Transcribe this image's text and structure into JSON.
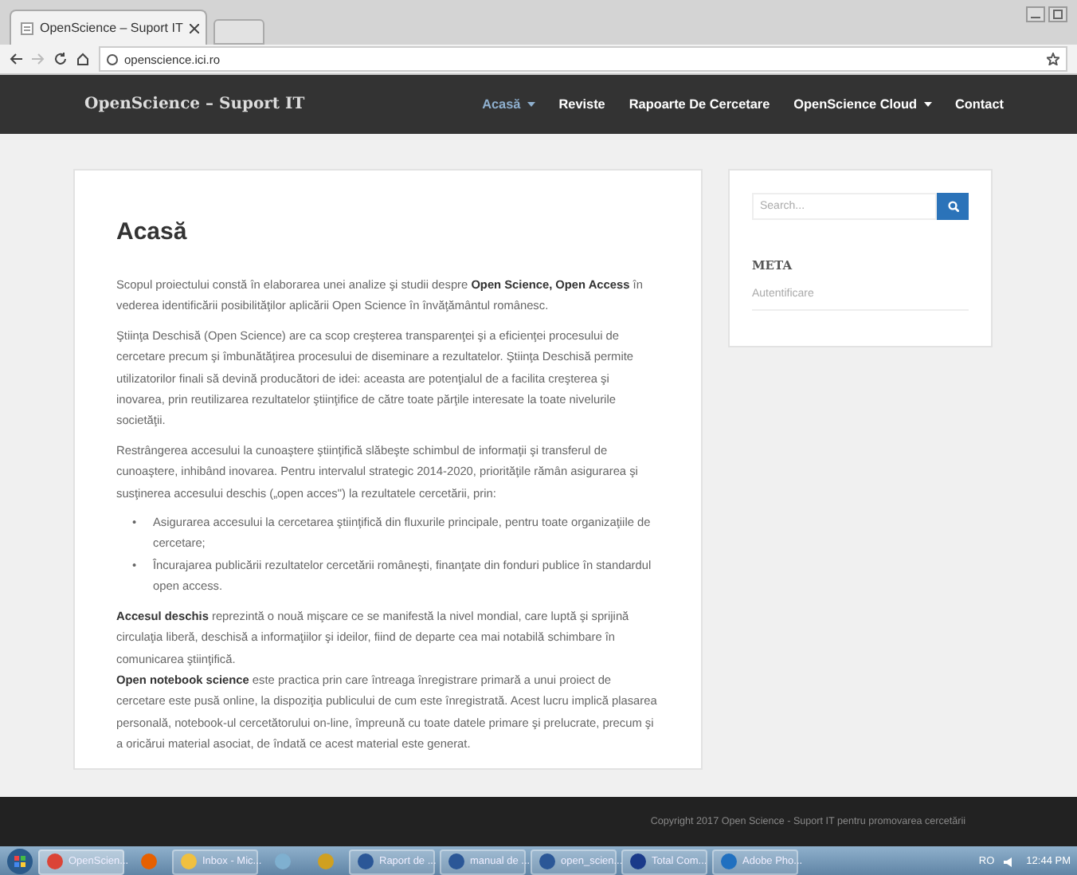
{
  "browser": {
    "tab_title": "OpenScience – Suport IT",
    "url": "openscience.ici.ro"
  },
  "site": {
    "brand": "OpenScience – Suport IT",
    "nav": [
      {
        "label": "Acasă",
        "selected": true,
        "dropdown": true
      },
      {
        "label": "Reviste",
        "selected": false,
        "dropdown": false
      },
      {
        "label": "Rapoarte De Cercetare",
        "selected": false,
        "dropdown": false
      },
      {
        "label": "OpenScience Cloud",
        "selected": false,
        "dropdown": true
      },
      {
        "label": "Contact",
        "selected": false,
        "dropdown": false
      }
    ]
  },
  "article": {
    "title": "Acasă",
    "blocks": [
      {
        "kind": "paragraph",
        "text": "Scopul proiectului constă în elaborarea unei analize şi studii despre **Open Science, Open Access** în vederea identificării posibilităţilor aplicării Open Science în învăţământul românesc."
      },
      {
        "kind": "paragraph",
        "text": "Ştiinţa Deschisă (Open Science) are ca scop creşterea transparenţei şi a eficienţei procesului de cercetare precum şi îmbunătăţirea procesului de diseminare a rezultatelor.  Ştiinţa Deschisă permite utilizatorilor finali să devină producători de idei: aceasta are potenţialul de a facilita creşterea şi inovarea, prin reutilizarea rezultatelor ştiinţifice de către toate părţile interesate la toate nivelurile societăţii."
      },
      {
        "kind": "paragraph",
        "text": "Restrângerea accesului la cunoaştere ştiinţifică slăbeşte schimbul de informaţii şi transferul de cunoaştere, inhibând inovarea. Pentru intervalul strategic 2014-2020, priorităţile rămân asigurarea şi susţinerea accesului deschis („open acces\") la rezultatele cercetării, prin:"
      },
      {
        "kind": "bullets",
        "items": [
          {
            "marker": "•",
            "text": "Asigurarea accesului la cercetarea ştiinţifică din fluxurile principale, pentru toate organizaţiile de cercetare;"
          },
          {
            "marker": "•",
            "text": "Încurajarea publicării rezultatelor cercetării româneşti, finanţate din fonduri publice în standardul open access."
          }
        ]
      },
      {
        "kind": "paragraph",
        "text": "**Accesul deschis** reprezintă o nouă mişcare ce se manifestă la nivel mondial, care luptă şi sprijină circulaţia liberă, deschisă a informaţiilor şi ideilor, fiind de departe cea mai notabilă schimbare în comunicarea ştiinţifică."
      },
      {
        "kind": "continuation",
        "text": "**Open notebook science** este practica prin care întreaga înregistrare primară a unui proiect de cercetare este pusă online, la dispoziţia publicului de cum este înregistrată. Acest lucru implică plasarea personală, notebook-ul cercetătorului on-line, împreună cu toate datele primare şi prelucrate, precum şi a oricărui material asociat, de îndată ce acest material este generat."
      }
    ]
  },
  "sidebar": {
    "search": {
      "placeholder": "Search..."
    },
    "meta_title": "META",
    "links": [
      "Autentificare"
    ]
  },
  "footer": {
    "copyright": "Copyright 2017 Open Science - Suport IT pentru promovarea cercetării"
  },
  "taskbar": {
    "items": [
      {
        "kind": "app",
        "label": "OpenScien...",
        "color": "#db4437",
        "selected": true
      },
      {
        "kind": "icon",
        "color": "#e66000",
        "selected": false
      },
      {
        "kind": "app",
        "label": "Inbox - Mic...",
        "color": "#f0c040",
        "selected": false
      },
      {
        "kind": "icon",
        "color": "#7fb0d0",
        "selected": false
      },
      {
        "kind": "icon",
        "color": "#d0a020",
        "selected": false
      },
      {
        "kind": "app",
        "label": "Raport de ...",
        "color": "#2b5797",
        "selected": false
      },
      {
        "kind": "app",
        "label": "manual de ...",
        "color": "#2b5797",
        "selected": false
      },
      {
        "kind": "app",
        "label": "open_scien...",
        "color": "#2b5797",
        "selected": false
      },
      {
        "kind": "app",
        "label": "Total Com...",
        "color": "#1a3a8a",
        "selected": false
      },
      {
        "kind": "app",
        "label": "Adobe Pho...",
        "color": "#2070c0",
        "selected": false
      }
    ],
    "language": "RO",
    "time": "12:44 PM"
  }
}
